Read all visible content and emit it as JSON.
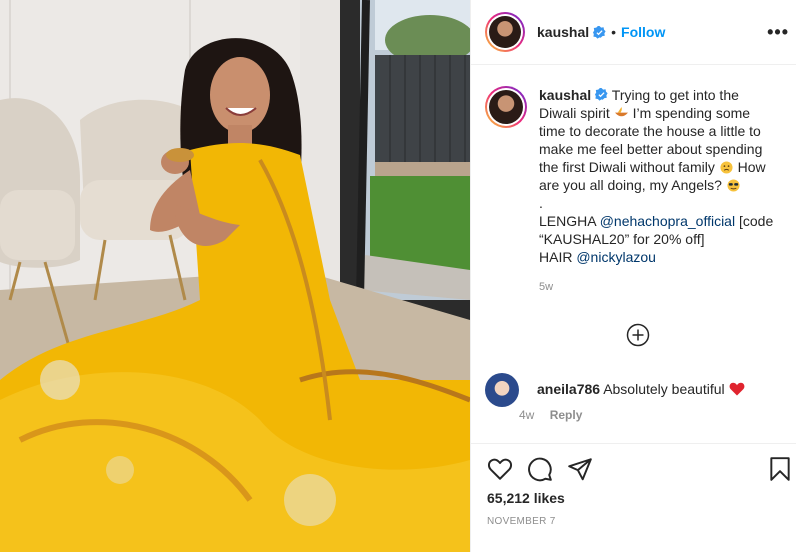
{
  "post": {
    "image_alt": "Woman in a yellow lehenga sitting on the floor holding a sweet"
  },
  "header": {
    "username": "kaushal",
    "separator": "•",
    "follow_label": "Follow",
    "more_label": "•••"
  },
  "caption": {
    "username": "kaushal",
    "line1": "Trying to get into the Diwali spirit",
    "line2": "I’m spending some time to decorate the house a little to make me feel better about spending the first Diwali without family",
    "line3": "How are you all doing, my Angels?",
    "dot_line": ".",
    "lengha_label": "LENGHA",
    "lengha_mention": "@nehachopra_official",
    "lengha_code": "[code “KAUSHAL20” for 20% off]",
    "hair_label": "HAIR",
    "hair_mention": "@nickylazou",
    "age": "5w"
  },
  "comment": {
    "username": "aneila786",
    "text": "Absolutely beautiful",
    "age": "4w",
    "reply_label": "Reply"
  },
  "footer": {
    "likes": "65,212 likes",
    "date": "NOVEMBER 7"
  },
  "colors": {
    "accent": "#0095f6",
    "verified": "#3897f0",
    "dress_yellow": "#f2b705",
    "text": "#262626",
    "muted": "#8e8e8e"
  }
}
